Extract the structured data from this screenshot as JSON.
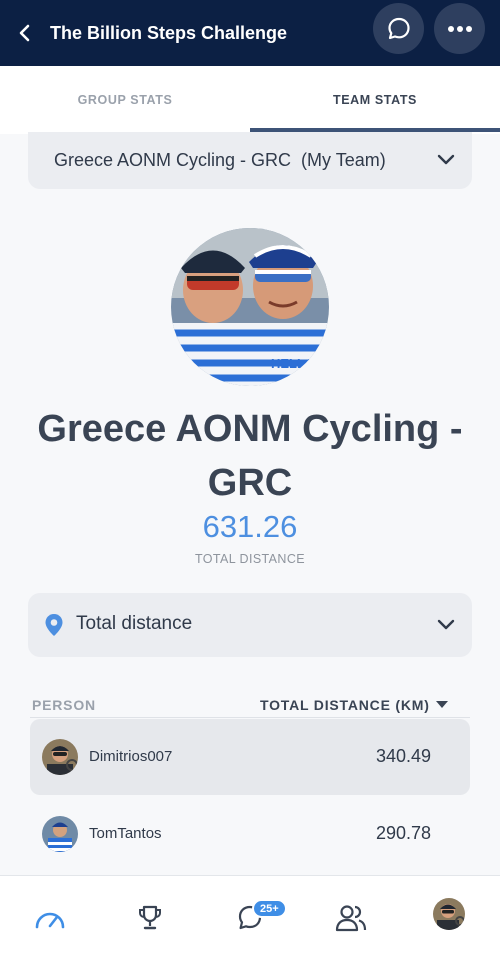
{
  "header": {
    "title": "The Billion Steps Challenge",
    "back_icon": "chevron-left-icon",
    "chat_icon": "chat-bubble-icon",
    "more_icon": "more-horizontal-icon"
  },
  "tabs": [
    {
      "label": "GROUP STATS",
      "active": false
    },
    {
      "label": "TEAM STATS",
      "active": true
    }
  ],
  "team_selector": {
    "label": "Greece AONM Cycling - GRC  (My Team)",
    "icon": "chevron-down-icon"
  },
  "team": {
    "name": "Greece AONM Cycling - GRC",
    "total_value": "631.26",
    "total_label": "TOTAL DISTANCE"
  },
  "metric_selector": {
    "label": "Total distance",
    "icon": "location-pin-icon"
  },
  "table": {
    "headers": {
      "person": "PERSON",
      "distance": "TOTAL DISTANCE (KM)"
    },
    "rows": [
      {
        "name": "Dimitrios007",
        "value": "340.49",
        "highlighted": true
      },
      {
        "name": "TomTantos",
        "value": "290.78",
        "highlighted": false
      }
    ]
  },
  "bottom_nav": {
    "items": [
      "dashboard-icon",
      "trophy-icon",
      "chat-icon",
      "team-icon",
      "profile-avatar"
    ],
    "chat_badge": "25+"
  },
  "colors": {
    "header_bg": "#0c2044",
    "accent": "#4d8fe0",
    "text": "#3a4454",
    "muted": "#9aa1ab"
  }
}
